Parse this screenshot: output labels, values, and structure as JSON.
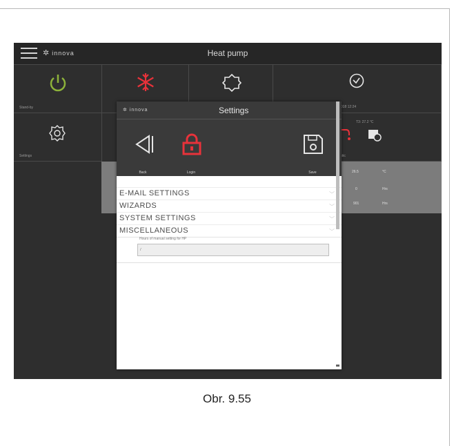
{
  "app": {
    "title": "Heat pump",
    "logo_text": "innova"
  },
  "tiles": {
    "standby_label": "Stand-by",
    "settings_label": "Settings",
    "datetime": "7/10/2018 12:24",
    "t3_temp": "T3: 27.2 °C",
    "domestic_label": "Domestic"
  },
  "table": {
    "rows": [
      {
        "value": "26.5",
        "unit": "°C"
      },
      {
        "value": "0",
        "unit": "Hrs"
      },
      {
        "value": "901",
        "unit": "Hrs"
      }
    ]
  },
  "dialog": {
    "title": "Settings",
    "logo_text": "innova",
    "toolbar": {
      "back_label": "Back",
      "login_label": "Login",
      "save_label": "Save"
    },
    "menu": [
      {
        "label": "E-MAIL SETTINGS"
      },
      {
        "label": "WIZARDS"
      },
      {
        "label": "SYSTEM SETTINGS"
      },
      {
        "label": "MISCELLANEOUS"
      }
    ],
    "setting": {
      "label": "Hours of manual setting for HP",
      "value": "7"
    }
  },
  "caption": "Obr. 9.55",
  "colors": {
    "accent_red": "#e8323a",
    "power_green": "#8db23a",
    "panel_dark": "#2e2e2e"
  },
  "icons": [
    "hamburger-icon",
    "power-icon",
    "snowflake-icon",
    "sun-icon",
    "clock-icon",
    "gear-icon",
    "faucet-icon",
    "calendar-clock-icon",
    "back-icon",
    "lock-icon",
    "save-icon",
    "chevron-down-icon"
  ]
}
